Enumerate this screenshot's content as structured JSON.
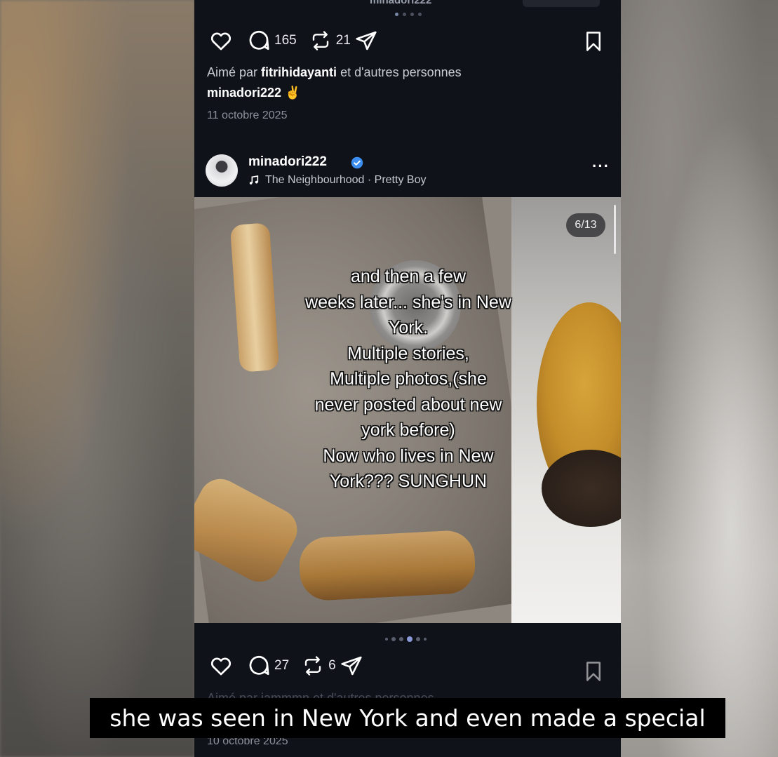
{
  "top_post": {
    "username_partial": "minadori222",
    "like_icon": "heart-icon",
    "comments_count": "165",
    "reposts_count": "21",
    "liked_by_prefix": "Aimé par",
    "liked_by_user": "fitrihidayanti",
    "liked_by_suffix": "et d'autres personnes",
    "caption": "minadori222 ✌️",
    "date": "11 octobre 2025"
  },
  "post": {
    "username": "minadori222",
    "verified_icon": "verified-badge-icon",
    "music": "The Neighbourhood · Pretty Boy",
    "more_label": "···",
    "counter": "6/13",
    "overlay_text": "and then a few\nweeks later... she's in New\nYork.\nMultiple stories,\nMultiple photos,(she\nnever posted about new\nyork before)\nNow who lives in New\nYork??? SUNGHUN",
    "comments_count": "27",
    "reposts_count": "6",
    "liked_by_partial": "Aimé par iammmn et d'autres personnes",
    "date": "10 octobre 2025"
  },
  "subtitle": "she was seen in New York and even made a special",
  "colors": {
    "app_bg": "#10121a",
    "verified": "#3b8ef0",
    "pager_active": "#8a9ad8"
  }
}
